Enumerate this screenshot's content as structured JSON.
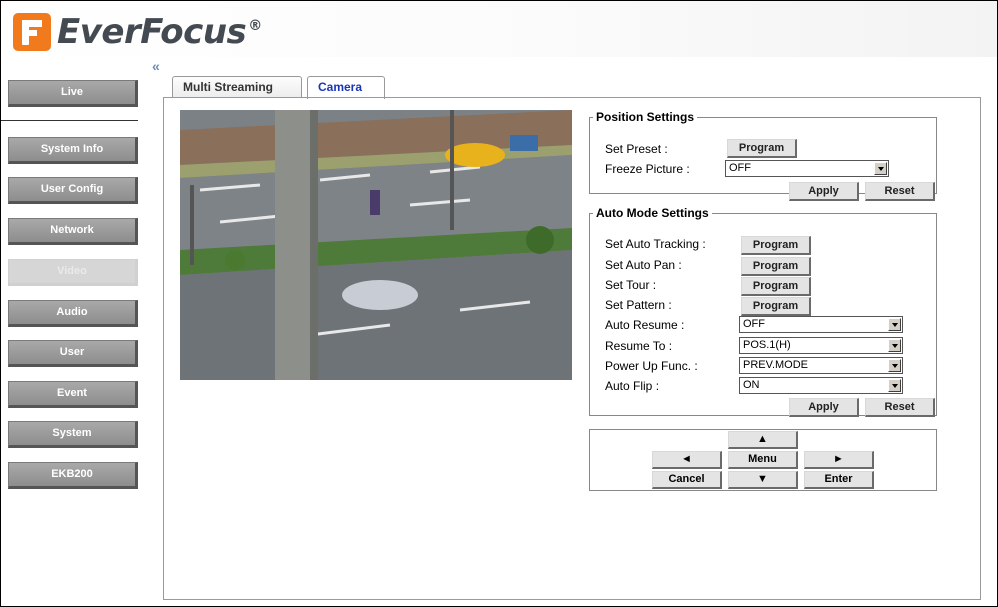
{
  "brand": {
    "name": "EverFocus",
    "reg": "®"
  },
  "sidebar": {
    "collapse_label": "«",
    "items": [
      {
        "label": "Live"
      },
      {
        "label": "System Info"
      },
      {
        "label": "User Config"
      },
      {
        "label": "Network"
      },
      {
        "label": "Video",
        "active": true
      },
      {
        "label": "Audio"
      },
      {
        "label": "User"
      },
      {
        "label": "Event"
      },
      {
        "label": "System"
      },
      {
        "label": "EKB200"
      }
    ]
  },
  "tabs": [
    {
      "label": "Multi Streaming"
    },
    {
      "label": "Camera",
      "active": true
    }
  ],
  "position_settings": {
    "legend": "Position Settings",
    "set_preset_label": "Set Preset :",
    "program_label": "Program",
    "freeze_label": "Freeze Picture :",
    "freeze_value": "OFF",
    "apply_label": "Apply",
    "reset_label": "Reset"
  },
  "auto_mode_settings": {
    "legend": "Auto Mode Settings",
    "tracking_label": "Set Auto Tracking :",
    "pan_label": "Set Auto Pan :",
    "tour_label": "Set Tour :",
    "pattern_label": "Set Pattern :",
    "program_label": "Program",
    "auto_resume_label": "Auto Resume :",
    "auto_resume_value": "OFF",
    "resume_to_label": "Resume To :",
    "resume_to_value": "POS.1(H)",
    "power_up_label": "Power Up Func. :",
    "power_up_value": "PREV.MODE",
    "auto_flip_label": "Auto Flip :",
    "auto_flip_value": "ON",
    "apply_label": "Apply",
    "reset_label": "Reset"
  },
  "ptz": {
    "up": "▲",
    "left": "◄",
    "menu": "Menu",
    "right": "►",
    "cancel": "Cancel",
    "down": "▼",
    "enter": "Enter"
  },
  "colors": {
    "logo_orange": "#f07a1c",
    "tab_active_text": "#1a36b8",
    "sidebar_button": "#999999"
  }
}
